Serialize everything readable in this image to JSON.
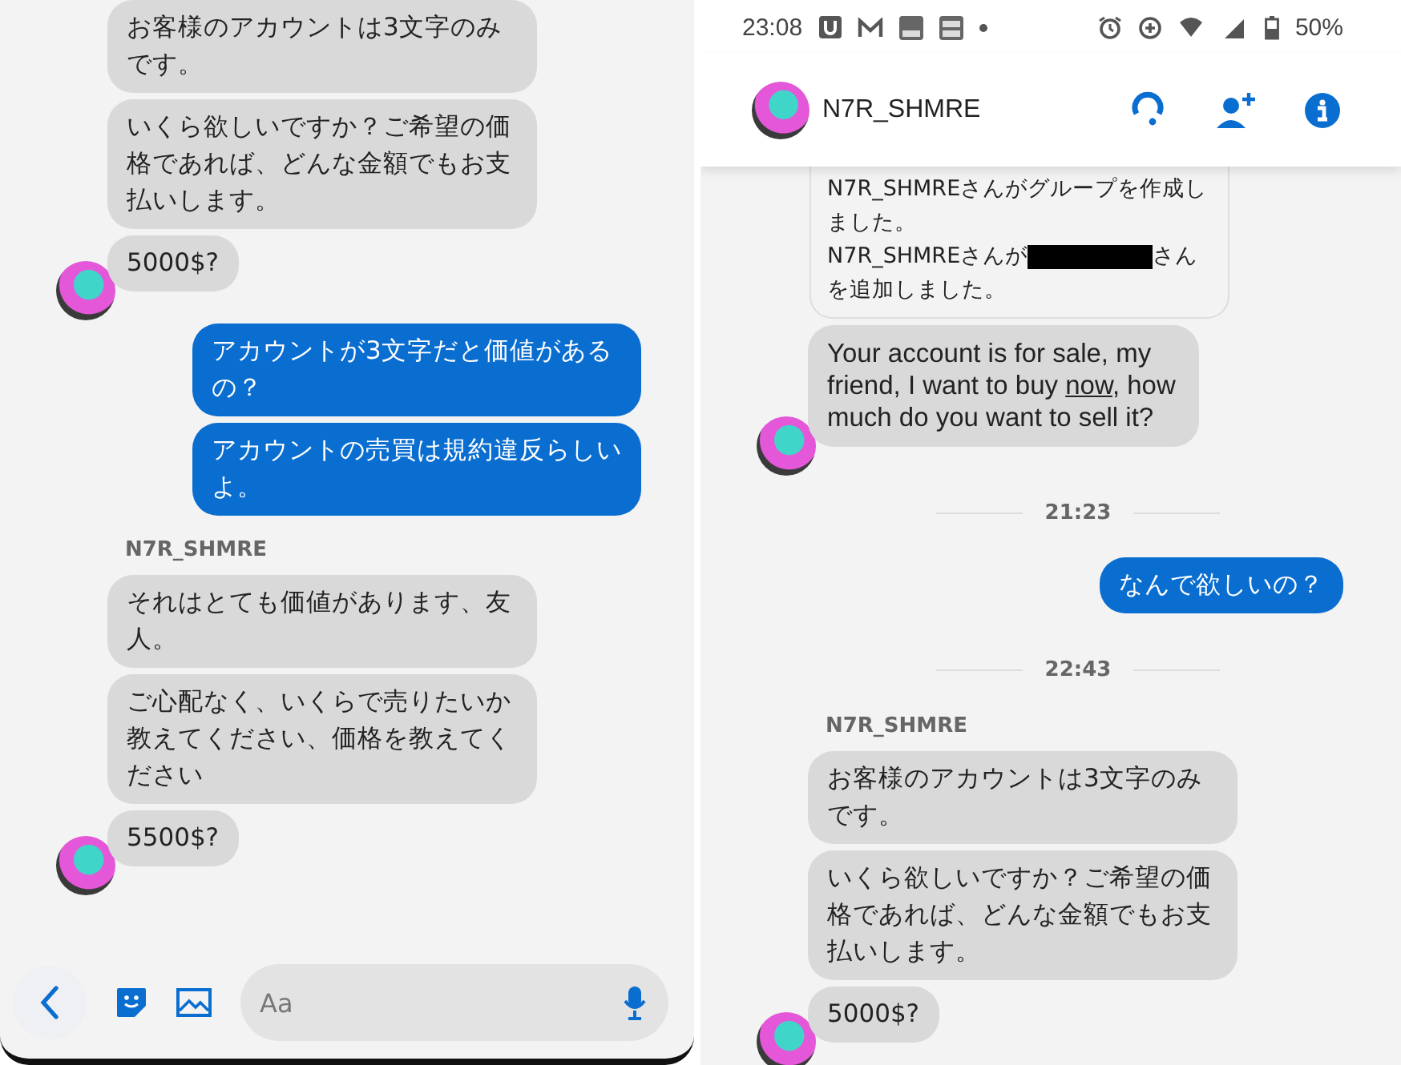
{
  "left_screen": {
    "thread": [
      {
        "kind": "incoming",
        "bubbles": [
          "お客様のアカウントは3文字のみです。",
          "いくら欲しいですか？ご希望の価格であれば、どんな金額でもお支払いします。",
          "5000$?"
        ]
      },
      {
        "kind": "outgoing",
        "bubbles": [
          "アカウントが3文字だと価値があるの？",
          "アカウントの売買は規約違反らしいよ。"
        ]
      },
      {
        "kind": "incoming",
        "sender": "N7R_SHMRE",
        "bubbles": [
          "それはとても価値があります、友人。",
          "ご心配なく、いくらで売りたいか教えてください、価格を教えてください",
          "5500$?"
        ]
      }
    ],
    "composer": {
      "placeholder": "Aa"
    }
  },
  "right_screen": {
    "status_bar": {
      "time": "23:08",
      "battery": "50%"
    },
    "header": {
      "title": "N7R_SHMRE"
    },
    "thread": [
      {
        "kind": "system",
        "line1": "N7R_SHMREさんがグループを作成しました。",
        "line2_before": "N7R_SHMREさんが",
        "line2_after": "さん",
        "line3": "を追加しました。"
      },
      {
        "kind": "incoming",
        "bubbles": [
          {
            "parts": [
              {
                "text": "Your account is for sale, my friend, I want to buy ",
                "link": false
              },
              {
                "text": "now",
                "link": true
              },
              {
                "text": ", how much do you want to sell it?",
                "link": false
              }
            ]
          }
        ]
      },
      {
        "kind": "time",
        "text": "21:23"
      },
      {
        "kind": "outgoing",
        "bubbles": [
          "なんで欲しいの？"
        ]
      },
      {
        "kind": "time",
        "text": "22:43"
      },
      {
        "kind": "incoming",
        "sender": "N7R_SHMRE",
        "bubbles": [
          "お客様のアカウントは3文字のみです。",
          "いくら欲しいですか？ご希望の価格であれば、どんな金額でもお支払いします。",
          "5000$?"
        ]
      }
    ]
  }
}
